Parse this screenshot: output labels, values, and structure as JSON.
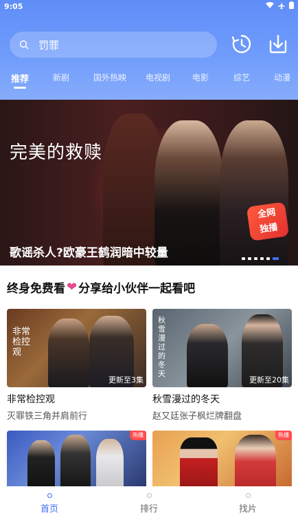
{
  "status_bar": {
    "time": "9:05"
  },
  "search": {
    "query": "罚罪"
  },
  "tabs": [
    "推荐",
    "新剧",
    "国外热映",
    "电视剧",
    "电影",
    "综艺",
    "动漫"
  ],
  "banner": {
    "poster_title": "完美的救赎",
    "caption": "歌谣杀人?欧豪王鹤润暗中较量",
    "exclusive_badge": [
      "全网",
      "独播"
    ],
    "slide_count": 6,
    "active_slide": 6
  },
  "promo": {
    "left": "终身免费看",
    "right": "分享给小伙伴一起看吧"
  },
  "cards": [
    {
      "badge": "更新至3集",
      "title": "非常检控观",
      "subtitle": "灭罪铁三角并肩前行",
      "poster_text": "非常检控观"
    },
    {
      "badge": "更新至20集",
      "title": "秋雪漫过的冬天",
      "subtitle": "赵又廷张子枫烂牌翻盘",
      "poster_text": "秋雪漫过的冬天"
    },
    {
      "hot": "热播"
    },
    {
      "hot": "热播"
    }
  ],
  "bottom_nav": [
    "首页",
    "排行",
    "找片"
  ],
  "colors": {
    "accent": "#3d6ef6",
    "header_top": "#5f8ef8",
    "heart": "#e8478b"
  }
}
